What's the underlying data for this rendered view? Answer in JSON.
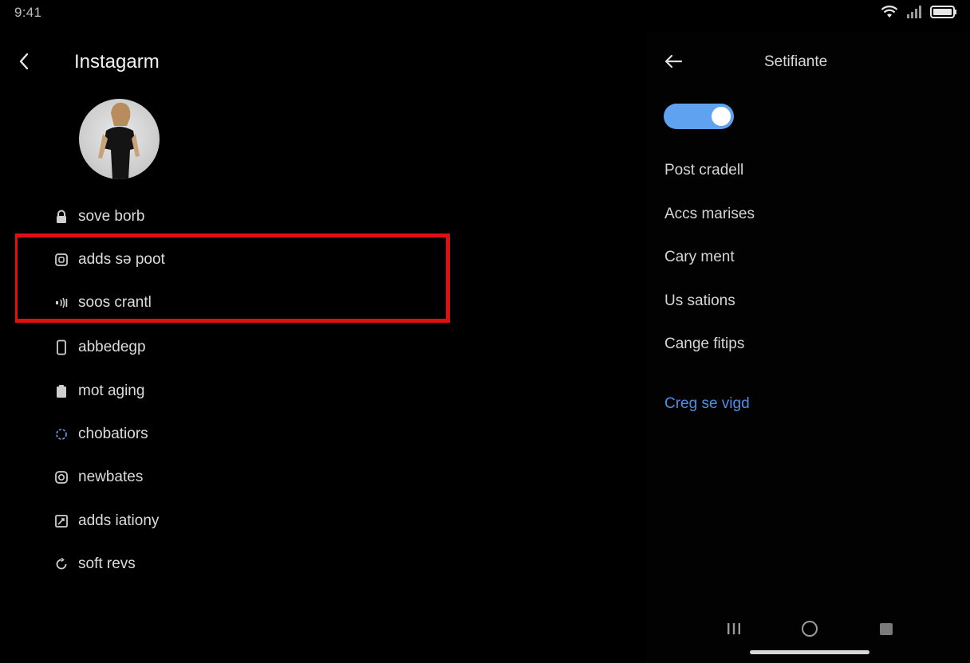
{
  "status_bar": {
    "time": "9:41",
    "icons": [
      "wifi-icon",
      "signal-icon",
      "battery-icon"
    ]
  },
  "left_pane": {
    "back_icon": "back-chevron-icon",
    "title": "Instagarm",
    "menu": [
      {
        "label": "sove borb",
        "icon": "lock-icon"
      },
      {
        "label": "adds sə poot",
        "icon": "app-square-icon"
      },
      {
        "label": "soos crantl",
        "icon": "sound-icon"
      },
      {
        "label": "abbedegp",
        "icon": "phone-icon"
      },
      {
        "label": "mot aging",
        "icon": "clipboard-icon"
      },
      {
        "label": "chobatiors",
        "icon": "loading-ring-icon"
      },
      {
        "label": "newbates",
        "icon": "camera-icon"
      },
      {
        "label": "adds iationy",
        "icon": "edit-square-icon"
      },
      {
        "label": "soft revs",
        "icon": "refresh-icon"
      }
    ]
  },
  "right_pane": {
    "back_icon": "back-arrow-icon",
    "title": "Setifiante",
    "toggle_on": true,
    "items": [
      "Post cradell",
      "Accs marises",
      "Cary ment",
      "Us sations",
      "Cange fitips"
    ],
    "link": "Creg se vigd"
  },
  "nav_bar": {
    "buttons": [
      "recents-icon",
      "home-circle-icon",
      "back-square-icon"
    ]
  },
  "colors": {
    "background": "#000000",
    "toggle": "#5fa2f0",
    "link": "#4d8fe6",
    "highlight": "#e10f0f"
  }
}
